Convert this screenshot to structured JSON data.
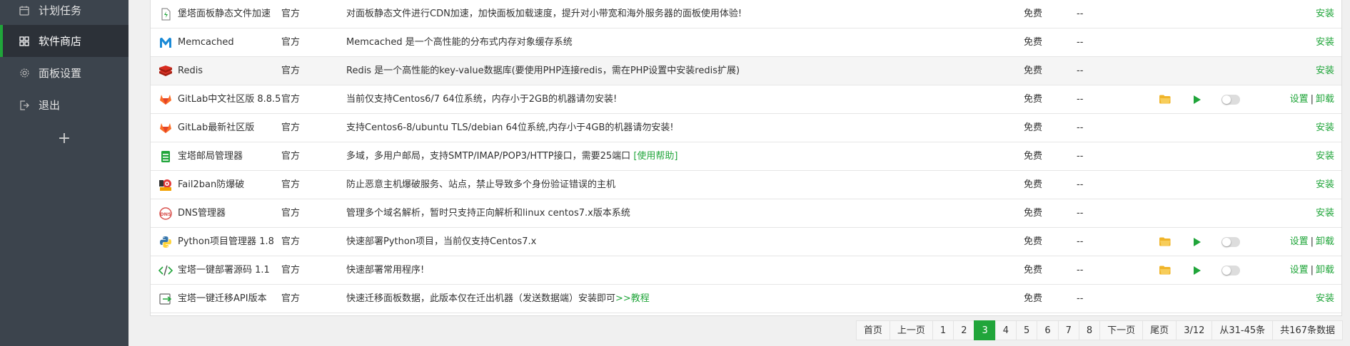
{
  "sidebar": {
    "items": [
      {
        "label": "计划任务",
        "icon": "calendar-icon"
      },
      {
        "label": "软件商店",
        "icon": "grid-icon"
      },
      {
        "label": "面板设置",
        "icon": "gear-icon"
      },
      {
        "label": "退出",
        "icon": "logout-icon"
      }
    ],
    "add_label": "+"
  },
  "plugins": [
    {
      "name": "堡塔面板静态文件加速",
      "icon": "cdn-icon",
      "dev": "官方",
      "desc": "对面板静态文件进行CDN加速，加快面板加载速度，提升对小带宽和海外服务器的面板使用体验!",
      "price": "免费",
      "expire": "--",
      "op": "安装"
    },
    {
      "name": "Memcached",
      "icon": "memcached-icon",
      "dev": "官方",
      "desc": "Memcached 是一个高性能的分布式内存对象缓存系统",
      "price": "免费",
      "expire": "--",
      "op": "安装"
    },
    {
      "name": "Redis",
      "icon": "redis-icon",
      "dev": "官方",
      "desc": "Redis 是一个高性能的key-value数据库(要使用PHP连接redis，需在PHP设置中安装redis扩展)",
      "price": "免费",
      "expire": "--",
      "op": "安装"
    },
    {
      "name": "GitLab中文社区版 8.8.5",
      "icon": "gitlab-icon",
      "dev": "官方",
      "desc": "当前仅支持Centos6/7 64位系统，内存小于2GB的机器请勿安装!",
      "price": "免费",
      "expire": "--",
      "op_setting": "设置",
      "op_uninstall": "卸载",
      "op_sep": "|"
    },
    {
      "name": "GitLab最新社区版",
      "icon": "gitlab-icon",
      "dev": "官方",
      "desc": "支持Centos6-8/ubuntu TLS/debian 64位系统,内存小于4GB的机器请勿安装!",
      "price": "免费",
      "expire": "--",
      "op": "安装"
    },
    {
      "name": "宝塔邮局管理器",
      "icon": "mail-server-icon",
      "dev": "官方",
      "desc": "多域，多用户邮局，支持SMTP/IMAP/POP3/HTTP接口，需要25端口",
      "desc_link": "[使用帮助]",
      "price": "免费",
      "expire": "--",
      "op": "安装"
    },
    {
      "name": "Fail2ban防爆破",
      "icon": "fail2ban-icon",
      "dev": "官方",
      "desc": "防止恶意主机爆破服务、站点，禁止导致多个身份验证错误的主机",
      "price": "免费",
      "expire": "--",
      "op": "安装"
    },
    {
      "name": "DNS管理器",
      "icon": "dns-icon",
      "dev": "官方",
      "desc": "管理多个域名解析，暂时只支持正向解析和linux centos7.x版本系统",
      "price": "免费",
      "expire": "--",
      "op": "安装"
    },
    {
      "name": "Python项目管理器 1.8",
      "icon": "python-icon",
      "dev": "官方",
      "desc": "快速部署Python项目，当前仅支持Centos7.x",
      "price": "免费",
      "expire": "--",
      "op_setting": "设置",
      "op_uninstall": "卸载",
      "op_sep": "|"
    },
    {
      "name": "宝塔一键部署源码 1.1",
      "icon": "code-icon",
      "dev": "官方",
      "desc": "快速部署常用程序!",
      "price": "免费",
      "expire": "--",
      "op_setting": "设置",
      "op_uninstall": "卸载",
      "op_sep": "|"
    },
    {
      "name": "宝塔一键迁移API版本",
      "icon": "migrate-icon",
      "dev": "官方",
      "desc": "快速迁移面板数据，此版本仅在迁出机器（发送数据端）安装即可",
      "desc_link": ">>教程",
      "price": "免费",
      "expire": "--",
      "op": "安装"
    }
  ],
  "pagination": {
    "first": "首页",
    "prev": "上一页",
    "pages": [
      "1",
      "2",
      "3",
      "4",
      "5",
      "6",
      "7",
      "8"
    ],
    "current": "3",
    "next": "下一页",
    "last": "尾页",
    "page_of": "3/12",
    "range": "从31-45条",
    "total": "共167条数据"
  },
  "colors": {
    "accent": "#20a53a",
    "sidebar_bg": "#3c444d",
    "sidebar_active": "#2c3138"
  }
}
